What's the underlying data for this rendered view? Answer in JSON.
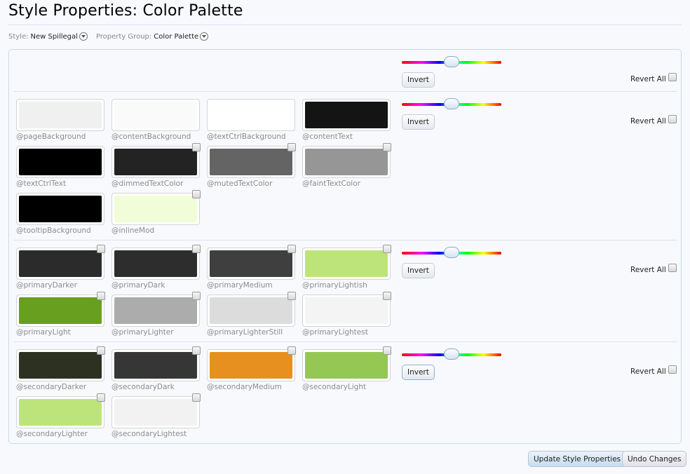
{
  "page": {
    "title": "Style Properties: Color Palette"
  },
  "filters": {
    "style_label": "Style:",
    "style_value": "New Spillegal",
    "group_label": "Property Group:",
    "group_value": "Color Palette"
  },
  "controls": {
    "invert_label": "Invert",
    "revert_all_label": "Revert All"
  },
  "groups": [
    {
      "name": "basic",
      "swatches": [
        {
          "label": "@pageBackground",
          "color": "#f0f0f0",
          "revert": false
        },
        {
          "label": "@contentBackground",
          "color": "#fafafa",
          "revert": false
        },
        {
          "label": "@textCtrlBackground",
          "color": "#ffffff",
          "revert": false
        },
        {
          "label": "@contentText",
          "color": "#141414",
          "revert": false
        },
        {
          "label": "@textCtrlText",
          "color": "#000000",
          "revert": false
        },
        {
          "label": "@dimmedTextColor",
          "color": "#232323",
          "revert": true
        },
        {
          "label": "@mutedTextColor",
          "color": "#646464",
          "revert": true
        },
        {
          "label": "@faintTextColor",
          "color": "#969696",
          "revert": true
        },
        {
          "label": "@tooltipBackground",
          "color": "#000000",
          "revert": false
        },
        {
          "label": "@inlineMod",
          "color": "#f1fdd8",
          "revert": true
        }
      ]
    },
    {
      "name": "primary",
      "swatches": [
        {
          "label": "@primaryDarker",
          "color": "#2b2b2b",
          "revert": true
        },
        {
          "label": "@primaryDark",
          "color": "#2d2d2d",
          "revert": true
        },
        {
          "label": "@primaryMedium",
          "color": "#3f3f3f",
          "revert": true
        },
        {
          "label": "@primaryLightish",
          "color": "#bde47b",
          "revert": true
        },
        {
          "label": "@primaryLight",
          "color": "#689f1f",
          "revert": true
        },
        {
          "label": "@primaryLighter",
          "color": "#acacac",
          "revert": true
        },
        {
          "label": "@primaryLighterStill",
          "color": "#dcdcdc",
          "revert": true
        },
        {
          "label": "@primaryLightest",
          "color": "#f4f4f4",
          "revert": true
        }
      ]
    },
    {
      "name": "secondary",
      "swatches": [
        {
          "label": "@secondaryDarker",
          "color": "#2c3122",
          "revert": true
        },
        {
          "label": "@secondaryDark",
          "color": "#363636",
          "revert": true
        },
        {
          "label": "@secondaryMedium",
          "color": "#e79020",
          "revert": true
        },
        {
          "label": "@secondaryLight",
          "color": "#95c754",
          "revert": true
        },
        {
          "label": "@secondaryLighter",
          "color": "#bde47b",
          "revert": true
        },
        {
          "label": "@secondaryLightest",
          "color": "#f2f2f2",
          "revert": true
        }
      ]
    }
  ],
  "footer": {
    "update_label": "Update Style Properties",
    "undo_label": "Undo Changes"
  }
}
